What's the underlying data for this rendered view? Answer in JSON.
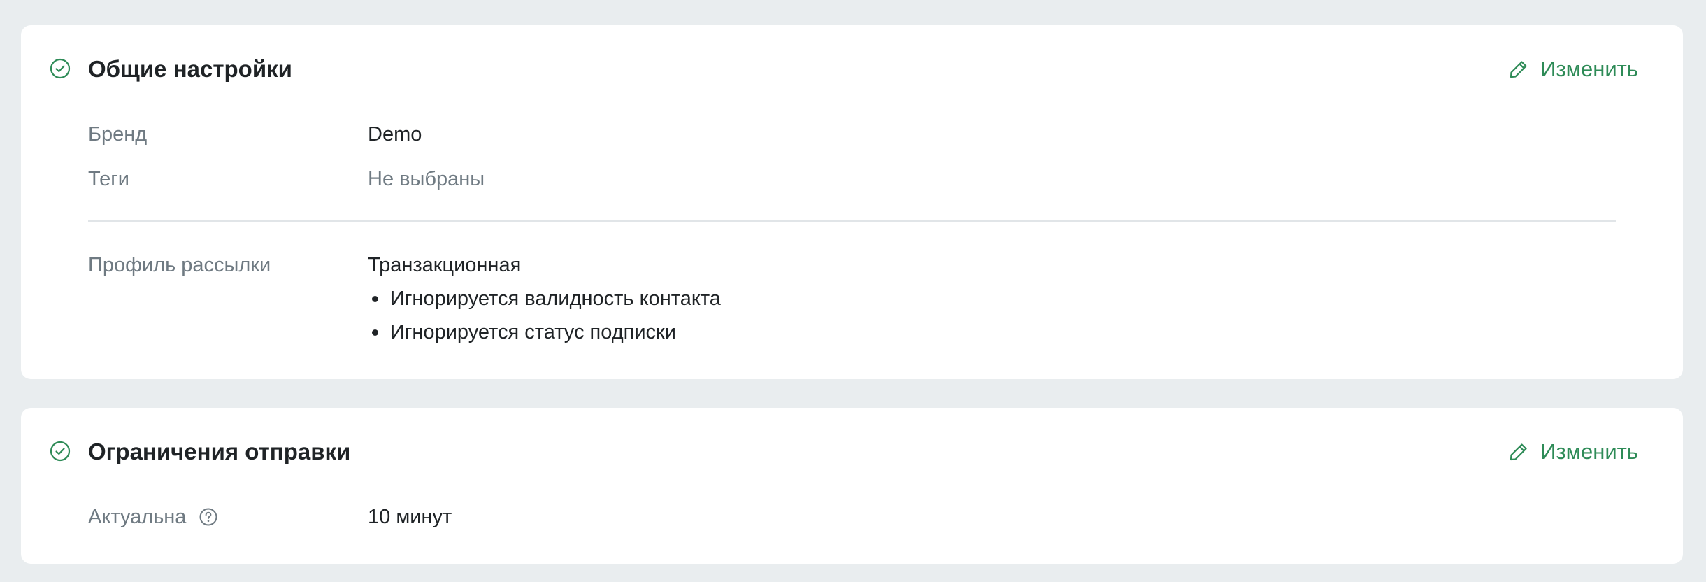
{
  "colors": {
    "page_background": "#e9edef",
    "card_background": "#ffffff",
    "accent_green": "#2e8b57",
    "text_primary": "#1f2326",
    "text_muted": "#6f7a82",
    "divider": "#e1e5e8"
  },
  "general_settings": {
    "status_icon": "check-circle-icon",
    "title": "Общие настройки",
    "edit_icon": "pencil-icon",
    "edit_label": "Изменить",
    "brand": {
      "label": "Бренд",
      "value": "Demo"
    },
    "tags": {
      "label": "Теги",
      "value": "Не выбраны"
    },
    "mailing_profile": {
      "label": "Профиль рассылки",
      "value": "Транзакционная",
      "items": [
        "Игнорируется валидность контакта",
        "Игнорируется статус подписки"
      ]
    }
  },
  "sending_limits": {
    "status_icon": "check-circle-icon",
    "title": "Ограничения отправки",
    "edit_icon": "pencil-icon",
    "edit_label": "Изменить",
    "relevance": {
      "label": "Актуальна",
      "help_icon": "question-circle-icon",
      "value": "10 минут"
    }
  }
}
